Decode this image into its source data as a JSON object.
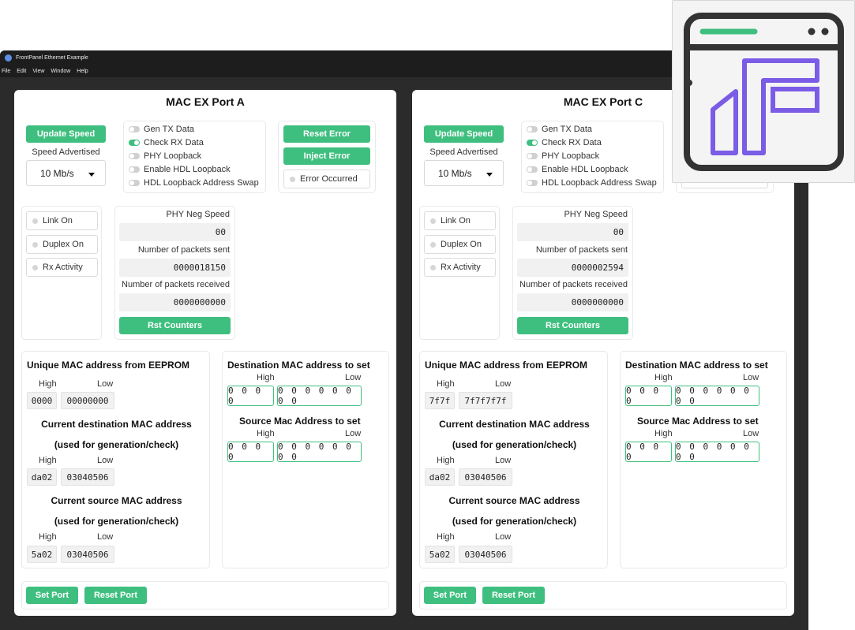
{
  "window": {
    "title": "FrontPanel Ethernet Example"
  },
  "menu": [
    "File",
    "Edit",
    "View",
    "Window",
    "Help"
  ],
  "colors": {
    "accent": "#3fbf7f",
    "window_bg": "#2b2b2b",
    "titlebar": "#1d1d1d",
    "logo_purple": "#7b5ce6",
    "logo_dark": "#333333",
    "logo_green": "#3fbf7f"
  },
  "labels": {
    "update_speed": "Update Speed",
    "speed_advertised": "Speed Advertised",
    "gen_tx": "Gen TX Data",
    "check_rx": "Check RX Data",
    "phy_loopback": "PHY Loopback",
    "hdl_loopback": "Enable HDL Loopback",
    "hdl_swap": "HDL Loopback Address Swap",
    "reset_error": "Reset Error",
    "inject_error": "Inject Error",
    "error_occurred": "Error Occurred",
    "link_on": "Link On",
    "duplex_on": "Duplex On",
    "rx_activity": "Rx Activity",
    "phy_neg_speed": "PHY Neg Speed",
    "packets_sent": "Number of packets sent",
    "packets_received": "Number of packets received",
    "rst_counters": "Rst Counters",
    "unique_mac": "Unique MAC address from EEPROM",
    "high": "High",
    "low": "Low",
    "current_dest_line1": "Current destination MAC address",
    "used_for": "(used for generation/check)",
    "current_src_line1": "Current source MAC address",
    "dest_to_set": "Destination MAC address to set",
    "src_to_set": "Source Mac Address to set",
    "set_port": "Set Port",
    "reset_port": "Reset Port"
  },
  "ports": [
    {
      "title": "MAC EX Port A",
      "speed": "10 Mb/s",
      "toggles": [
        false,
        true,
        false,
        false,
        false
      ],
      "phy_neg_speed": "00",
      "packets_sent": "0000018150",
      "packets_received": "0000000000",
      "eeprom_high": "0000",
      "eeprom_low": "00000000",
      "cur_dest_high": "da02",
      "cur_dest_low": "03040506",
      "cur_src_high": "5a02",
      "cur_src_low": "03040506",
      "set_dest_high": "0000",
      "set_dest_low": "00000000",
      "set_src_high": "0000",
      "set_src_low": "00000000"
    },
    {
      "title": "MAC EX Port C",
      "speed": "10 Mb/s",
      "toggles": [
        false,
        true,
        false,
        false,
        false
      ],
      "phy_neg_speed": "00",
      "packets_sent": "0000002594",
      "packets_received": "0000000000",
      "eeprom_high": "7f7f",
      "eeprom_low": "7f7f7f7f",
      "cur_dest_high": "da02",
      "cur_dest_low": "03040506",
      "cur_src_high": "5a02",
      "cur_src_low": "03040506",
      "set_dest_high": "0000",
      "set_dest_low": "00000000",
      "set_src_high": "0000",
      "set_src_low": "00000000"
    }
  ]
}
